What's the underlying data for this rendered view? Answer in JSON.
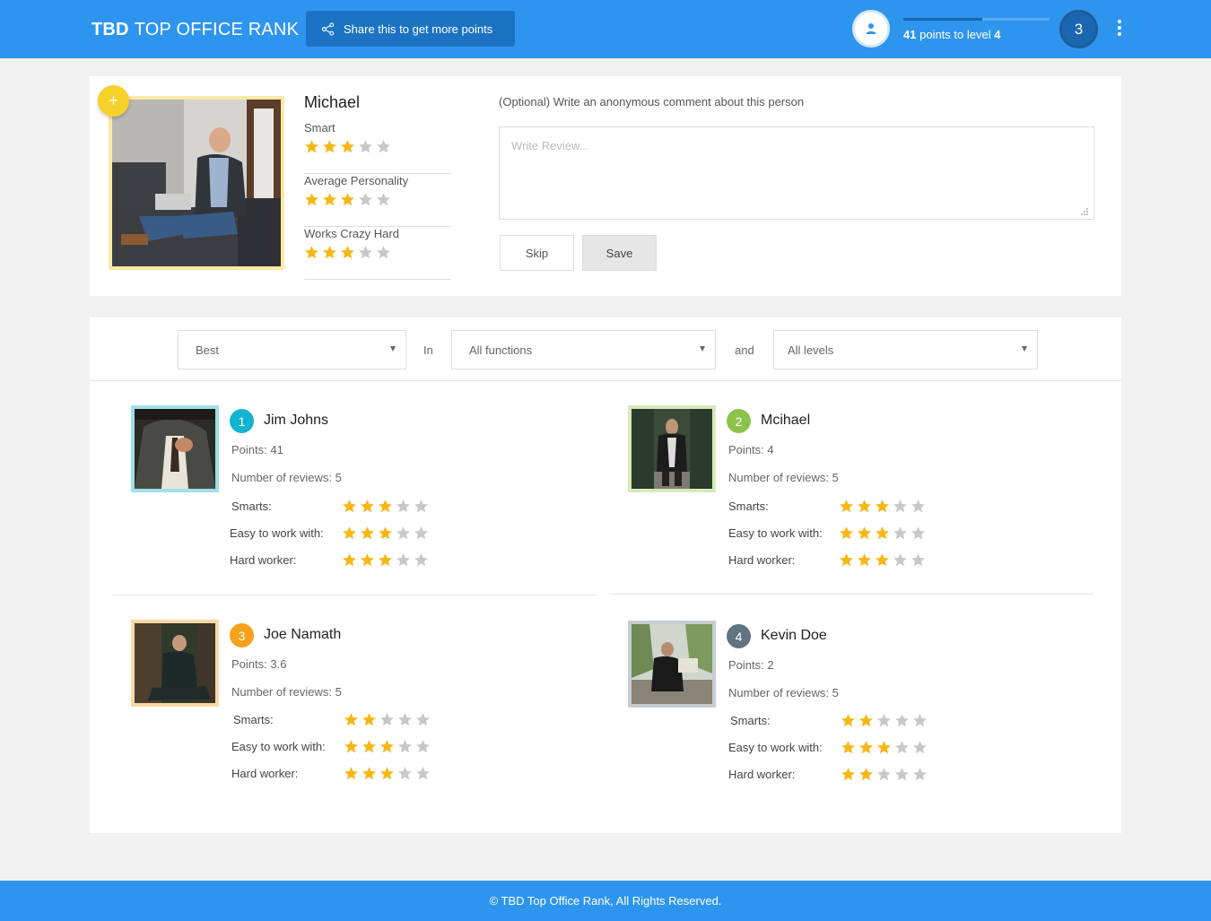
{
  "header": {
    "brand_bold": "TBD",
    "brand_rest": "TOP OFFICE RANK",
    "share_label": "Share this to get more points",
    "points_value": "41",
    "points_text": "points to level",
    "next_level": "4",
    "current_level": "3",
    "level_progress": 0.54,
    "colors": {
      "bar": "#2e95ef",
      "dark": "#1a66b0"
    }
  },
  "review": {
    "name": "Michael",
    "plus_symbol": "+",
    "traits": [
      {
        "label": "Smart",
        "rating": 3
      },
      {
        "label": "Average Personality",
        "rating": 3
      },
      {
        "label": "Works Crazy Hard",
        "rating": 3
      }
    ],
    "comment_label": "(Optional) Write an anonymous comment about this person",
    "placeholder": "Write Review...",
    "skip_label": "Skip",
    "save_label": "Save"
  },
  "filters": {
    "sort": "Best",
    "in_word": "In",
    "function": "All functions",
    "and_word": "and",
    "level": "All levels"
  },
  "leaders": [
    {
      "rank": "1",
      "name": "Jim Johns",
      "points": "Points: 41",
      "reviews": "Number of reviews: 5",
      "color": "#12b5d1",
      "frame": "#9fdfe9",
      "ratings": [
        {
          "label": "Smarts:",
          "value": 3
        },
        {
          "label": "Easy to work with:",
          "value": 3
        },
        {
          "label": "Hard worker:",
          "value": 3
        }
      ]
    },
    {
      "rank": "2",
      "name": "Mcihael",
      "points": "Points: 4",
      "reviews": "Number of reviews: 5",
      "color": "#8bc34a",
      "frame": "#d6ebb9",
      "ratings": [
        {
          "label": "Smarts:",
          "value": 3
        },
        {
          "label": "Easy to work with:",
          "value": 3
        },
        {
          "label": "Hard worker:",
          "value": 3
        }
      ]
    },
    {
      "rank": "3",
      "name": "Joe Namath",
      "points": "Points: 3.6",
      "reviews": "Number of reviews: 5",
      "color": "#f7a01a",
      "frame": "#fbd9a6",
      "ratings": [
        {
          "label": "Smarts:",
          "value": 2
        },
        {
          "label": "Easy to work with:",
          "value": 3
        },
        {
          "label": "Hard worker:",
          "value": 3
        }
      ]
    },
    {
      "rank": "4",
      "name": "Kevin Doe",
      "points": "Points: 2",
      "reviews": "Number of reviews: 5",
      "color": "#5f7380",
      "frame": "#c4cdd3",
      "ratings": [
        {
          "label": "Smarts:",
          "value": 2
        },
        {
          "label": "Easy to work with:",
          "value": 3
        },
        {
          "label": "Hard worker:",
          "value": 2
        }
      ]
    }
  ],
  "footer": {
    "text": "© TBD Top Office Rank, All Rights Reserved."
  },
  "star_colors": {
    "filled": "#f7b718",
    "empty": "#c8c8c8"
  }
}
